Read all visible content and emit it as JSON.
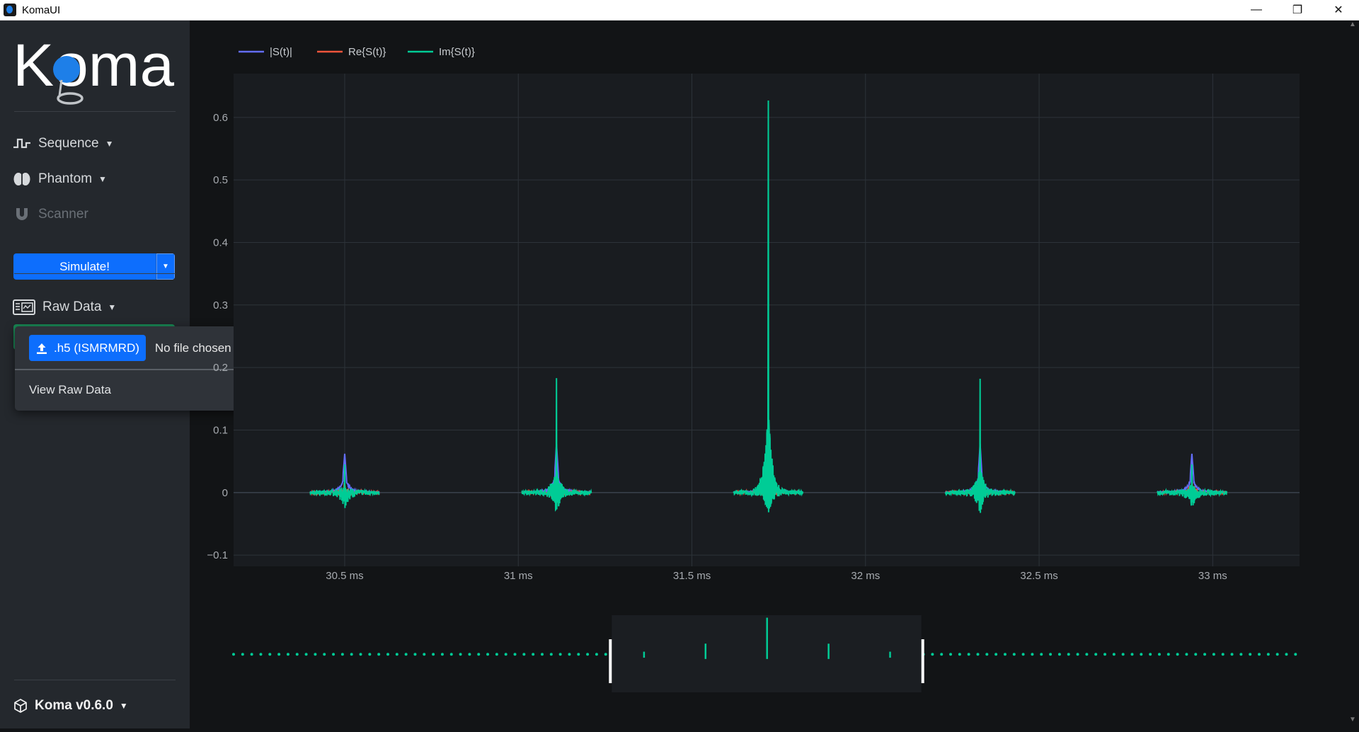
{
  "window": {
    "title": "KomaUI",
    "minimize_glyph": "—",
    "maximize_glyph": "❐",
    "close_glyph": "✕"
  },
  "sidebar": {
    "logo_text": "Koma",
    "items": [
      {
        "label": "Sequence",
        "icon": "sequence-pulse-icon"
      },
      {
        "label": "Phantom",
        "icon": "brain-icon"
      },
      {
        "label": "Scanner",
        "icon": "magnet-icon"
      }
    ],
    "simulate_label": "Simulate!",
    "raw_data_label": "Raw Data",
    "version_label": "Koma v0.6.0"
  },
  "raw_dropdown": {
    "file_button_label": ".h5 (ISMRMRD)",
    "file_status": "No file chosen",
    "view_label": "View Raw Data"
  },
  "colors": {
    "abs": "#636efa",
    "real": "#ef553b",
    "imag": "#00cc96",
    "accent": "#0d6efd"
  },
  "chart_data": {
    "type": "line",
    "legend": [
      "|S(t)|",
      "Re{S(t)}",
      "Im{S(t)}"
    ],
    "legend_position": "top-left",
    "grid": true,
    "xlim": [
      30.18,
      33.25
    ],
    "ylim": [
      -0.118,
      0.67
    ],
    "x_ticks": [
      30.5,
      31,
      31.5,
      32,
      32.5,
      33
    ],
    "x_tick_labels": [
      "30.5 ms",
      "31 ms",
      "31.5 ms",
      "32 ms",
      "32.5 ms",
      "33 ms"
    ],
    "y_ticks": [
      -0.1,
      0,
      0.1,
      0.2,
      0.3,
      0.4,
      0.5,
      0.6
    ],
    "y_tick_labels": [
      "−0.1",
      "0",
      "0.1",
      "0.2",
      "0.3",
      "0.4",
      "0.5",
      "0.6"
    ],
    "echo_window_half_width_ms": 0.1,
    "echoes": [
      {
        "center_ms": 30.5,
        "abs_peak": 0.062,
        "im_max": 0.045,
        "im_min": -0.058
      },
      {
        "center_ms": 31.11,
        "abs_peak": 0.078,
        "im_max": 0.183,
        "im_min": -0.08
      },
      {
        "center_ms": 31.72,
        "abs_peak": 0.06,
        "im_max": 0.627,
        "im_min": -0.08
      },
      {
        "center_ms": 32.33,
        "abs_peak": 0.078,
        "im_max": 0.182,
        "im_min": -0.08
      },
      {
        "center_ms": 32.94,
        "abs_peak": 0.062,
        "im_max": 0.045,
        "im_min": -0.058
      }
    ],
    "rangeslider": {
      "enabled": true,
      "selected_range_ms": [
        30.18,
        33.25
      ]
    }
  }
}
